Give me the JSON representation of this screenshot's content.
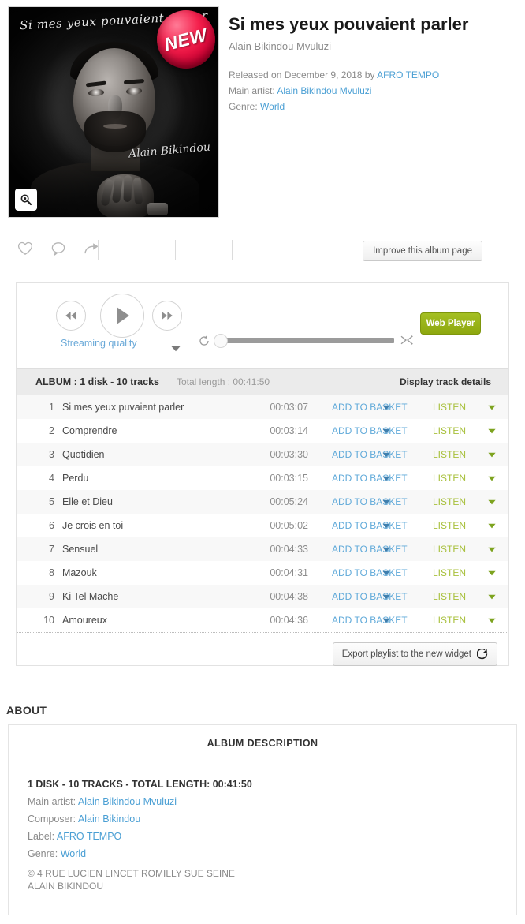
{
  "album": {
    "title": "Si mes yeux pouvaient parler",
    "artist": "Alain Bikindou Mvuluzi",
    "released_prefix": "Released on December 9, 2018 by",
    "released_label": "AFRO TEMPO",
    "main_artist_label": "Main artist:",
    "main_artist": "Alain Bikindou Mvuluzi",
    "genre_label": "Genre:",
    "genre": "World",
    "cover_title_text": "Si mes yeux pouvaient parler",
    "cover_signature": "Alain Bikindou",
    "new_badge": "NEW",
    "zoom_icon": "magnifier-icon"
  },
  "actions": {
    "like_icon": "heart-icon",
    "comment_icon": "comment-icon",
    "share_icon": "share-icon",
    "improve_label": "Improve this album page"
  },
  "player": {
    "prev_icon": "rewind-icon",
    "play_icon": "play-icon",
    "next_icon": "fast-forward-icon",
    "streaming_quality_label": "Streaming quality",
    "streaming_caret_icon": "chevron-down-icon",
    "repeat_icon": "repeat-icon",
    "shuffle_icon": "shuffle-icon",
    "web_player_label": "Web Player",
    "web_player_color": "#9ab41c",
    "progress_percent": 0
  },
  "tracklist": {
    "header": {
      "album_label": "ALBUM : 1 disk - 10 tracks",
      "total_length": "Total length : 00:41:50",
      "display_details": "Display track details"
    },
    "basket_label": "ADD TO BASKET",
    "listen_label": "LISTEN",
    "basket_color": "#5fa9d9",
    "listen_color": "#a8c03c",
    "tracks": [
      {
        "num": "1",
        "title": "Si mes yeux puvaient parler",
        "duration": "00:03:07"
      },
      {
        "num": "2",
        "title": "Comprendre",
        "duration": "00:03:14"
      },
      {
        "num": "3",
        "title": "Quotidien",
        "duration": "00:03:30"
      },
      {
        "num": "4",
        "title": "Perdu",
        "duration": "00:03:15"
      },
      {
        "num": "5",
        "title": "Elle et Dieu",
        "duration": "00:05:24"
      },
      {
        "num": "6",
        "title": "Je crois en toi",
        "duration": "00:05:02"
      },
      {
        "num": "7",
        "title": "Sensuel",
        "duration": "00:04:33"
      },
      {
        "num": "8",
        "title": "Mazouk",
        "duration": "00:04:31"
      },
      {
        "num": "9",
        "title": "Ki Tel Mache",
        "duration": "00:04:38"
      },
      {
        "num": "10",
        "title": "Amoureux",
        "duration": "00:04:36"
      }
    ],
    "export_label": "Export playlist to the new widget",
    "export_icon": "external-link-icon"
  },
  "about": {
    "section_heading": "ABOUT",
    "card_title": "ALBUM DESCRIPTION",
    "summary": "1 DISK - 10 TRACKS - TOTAL LENGTH: 00:41:50",
    "main_artist_label": "Main artist:",
    "main_artist": "Alain Bikindou Mvuluzi",
    "composer_label": "Composer:",
    "composer": "Alain Bikindou",
    "label_label": "Label:",
    "label": "AFRO TEMPO",
    "genre_label": "Genre:",
    "genre": "World",
    "copyright_line1": "© 4 RUE LUCIEN LINCET ROMILLY SUE SEINE",
    "copyright_line2": "ALAIN BIKINDOU"
  }
}
